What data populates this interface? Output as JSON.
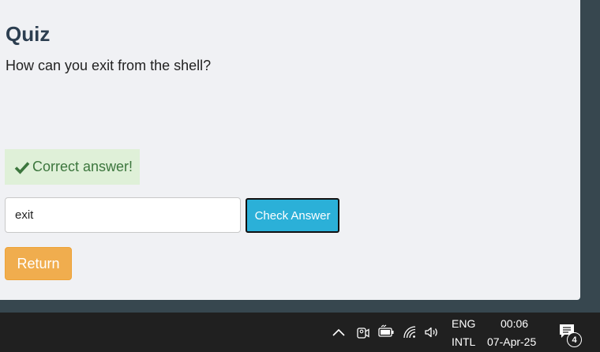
{
  "quiz": {
    "title": "Quiz",
    "question": "How can you exit from the shell?",
    "feedback": "Correct answer!",
    "answer_value": "exit",
    "check_label": "Check Answer",
    "return_label": "Return"
  },
  "colors": {
    "card_background": "#f0f1f4",
    "success_background": "#dff0d8",
    "success_text": "#3c763d",
    "check_button": "#2bb0d8",
    "return_button": "#f0ad4e",
    "taskbar": "#202020"
  },
  "taskbar": {
    "icons": [
      "chevron-up-icon",
      "meet-now-icon",
      "battery-icon",
      "wifi-icon",
      "volume-icon",
      "notification-icon"
    ],
    "language_line1": "ENG",
    "language_line2": "INTL",
    "time": "00:06",
    "date": "07-Apr-25",
    "notification_count": "4"
  }
}
